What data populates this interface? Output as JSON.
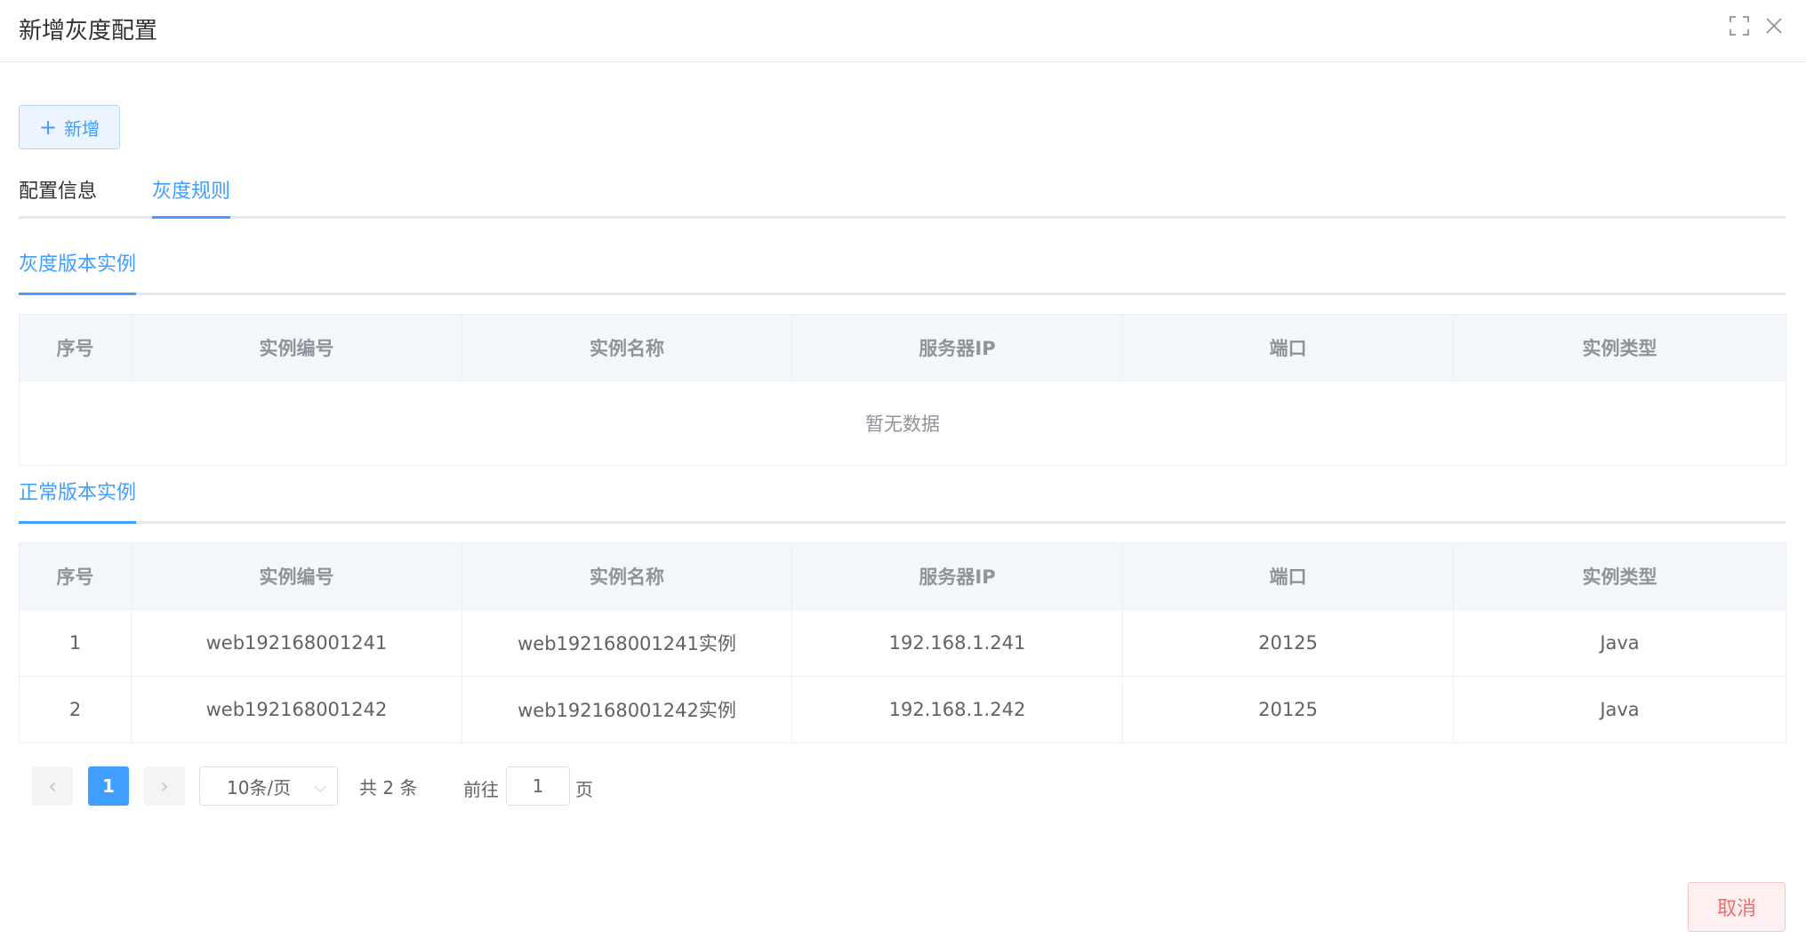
{
  "dialog": {
    "title": "新增灰度配置"
  },
  "toolbar": {
    "add_icon": "plus-icon",
    "add_label": "新增"
  },
  "tabs": [
    {
      "label": "配置信息",
      "active": false
    },
    {
      "label": "灰度规则",
      "active": true
    }
  ],
  "gray_section": {
    "title": "灰度版本实例",
    "columns": [
      "序号",
      "实例编号",
      "实例名称",
      "服务器IP",
      "端口",
      "实例类型"
    ],
    "empty_text": "暂无数据"
  },
  "normal_section": {
    "title": "正常版本实例",
    "columns": [
      "序号",
      "实例编号",
      "实例名称",
      "服务器IP",
      "端口",
      "实例类型"
    ],
    "rows": [
      [
        "1",
        "web192168001241",
        "web192168001241实例",
        "192.168.1.241",
        "20125",
        "Java"
      ],
      [
        "2",
        "web192168001242",
        "web192168001242实例",
        "192.168.1.242",
        "20125",
        "Java"
      ]
    ]
  },
  "pagination": {
    "prev_icon": "chevron-left-icon",
    "next_icon": "chevron-right-icon",
    "current_page": "1",
    "page_size": "10条/页",
    "total": "共 2 条",
    "goto_label": "前往",
    "goto_value": "1",
    "page_suffix": "页"
  },
  "footer": {
    "cancel_label": "取消"
  },
  "colors": {
    "primary": "#409eff",
    "danger": "#f56c6c",
    "header_bg": "#f3f6fa"
  }
}
